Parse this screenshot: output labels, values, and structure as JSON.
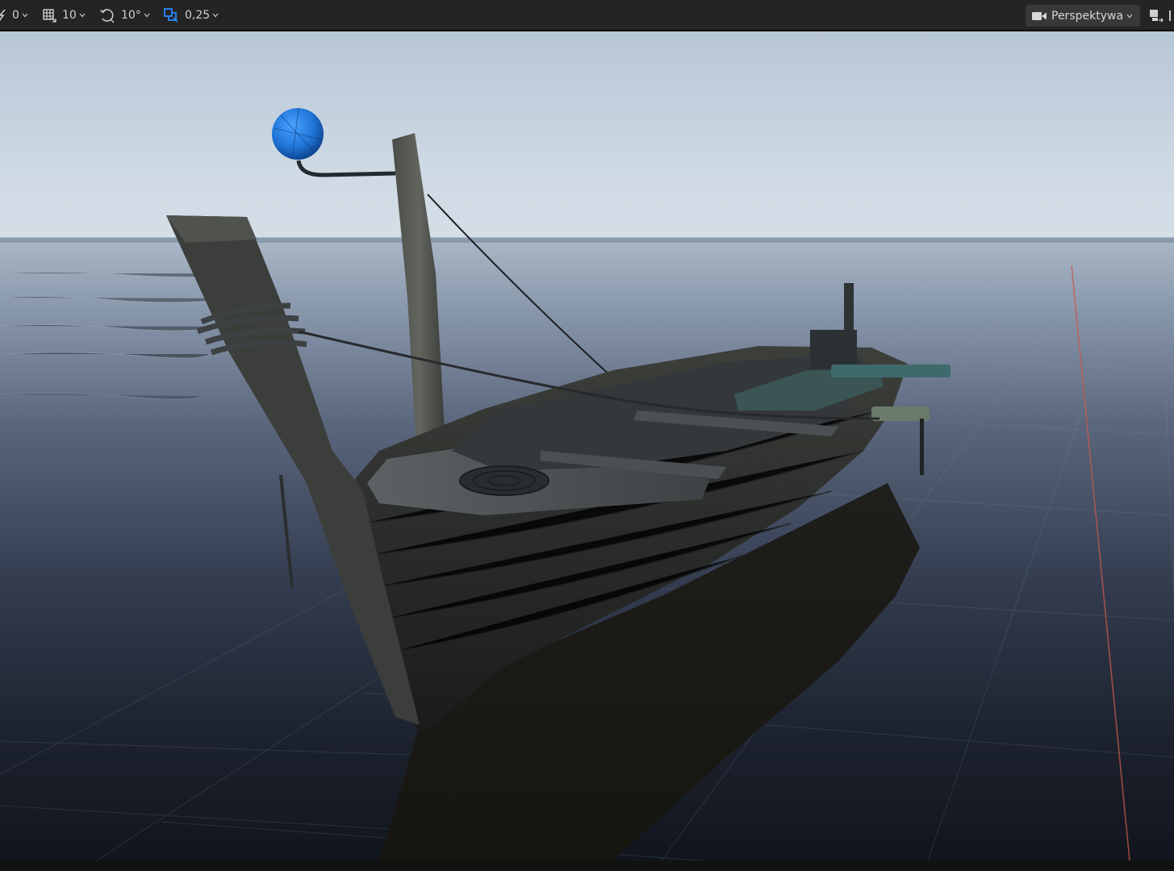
{
  "toolbar": {
    "surface_snap": {
      "value": "0",
      "icon": "surface-snap-icon"
    },
    "grid_snap": {
      "value": "10",
      "icon": "grid-icon"
    },
    "rotation_snap": {
      "value": "10°",
      "icon": "rotate-icon"
    },
    "scale_snap": {
      "value": "0,25",
      "icon": "scale-icon"
    },
    "view_mode": {
      "label": "Perspektywa",
      "icon": "camera-icon"
    },
    "layout_icon": "viewport-layout-icon"
  },
  "colors": {
    "toolbar_bg": "#242424",
    "accent_blue": "#2a8bff",
    "buoy_blue": "#1f74d6"
  }
}
